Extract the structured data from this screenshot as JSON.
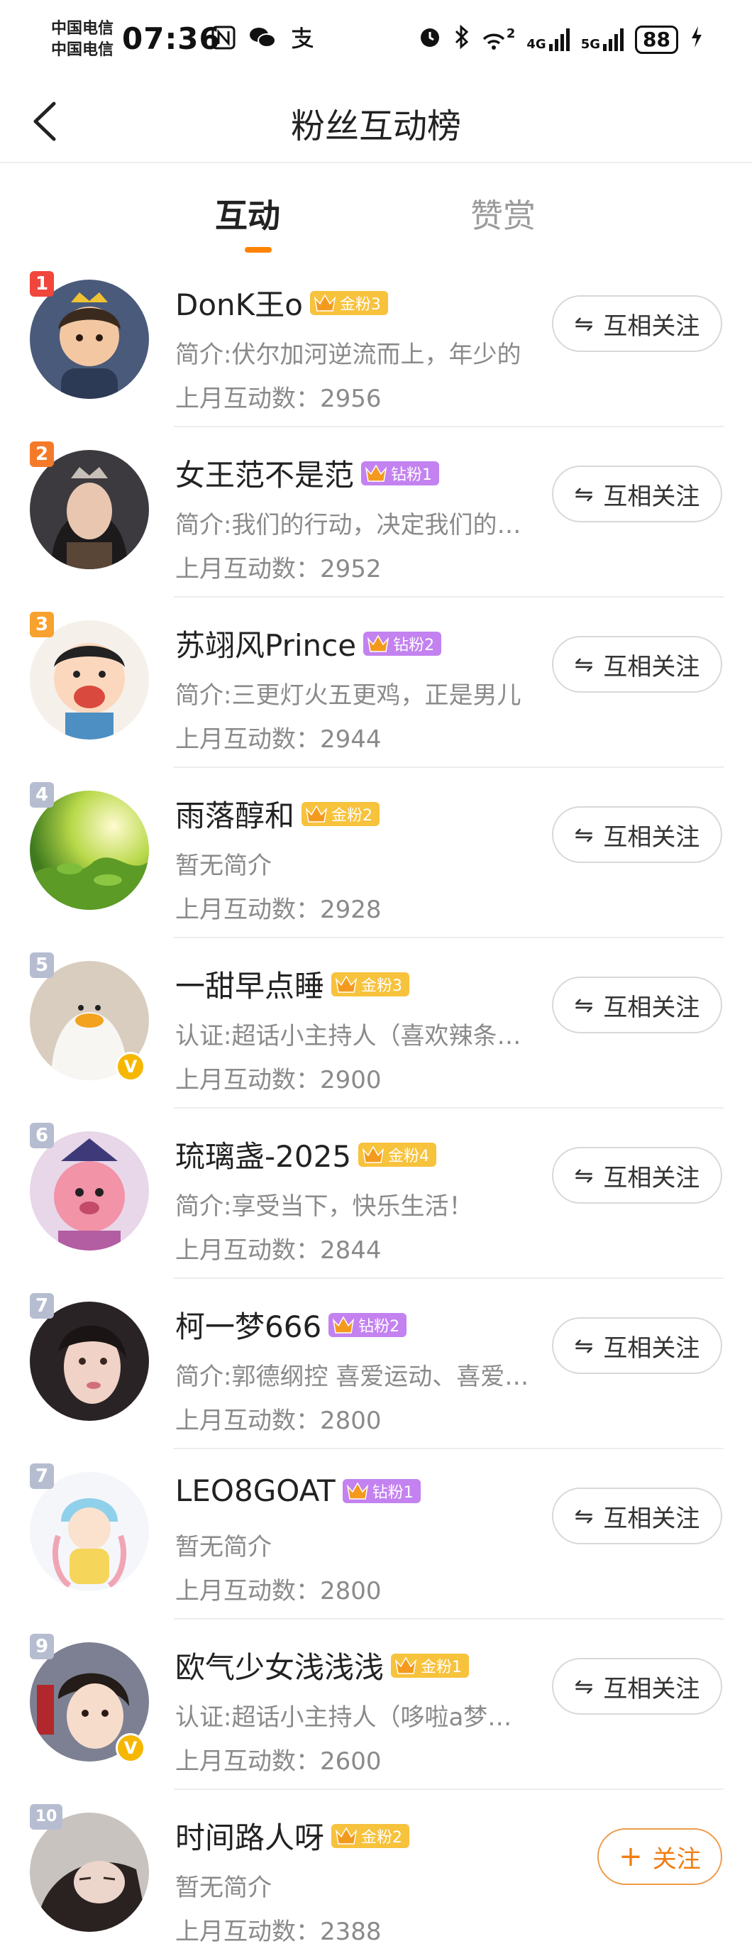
{
  "status_bar": {
    "carrier_1": "中国电信",
    "carrier_2": "中国电信",
    "time": "07:36",
    "net_1": "4G",
    "net_2": "5G",
    "sim_index": "2",
    "battery": "88",
    "left_icons": [
      "nfc-icon",
      "wechat-icon",
      "alipay-icon"
    ],
    "right_icons": [
      "alarm-icon",
      "bluetooth-icon",
      "wifi-icon",
      "signal-icon",
      "signal-icon",
      "charging-icon"
    ]
  },
  "header": {
    "title": "粉丝互动榜",
    "back_icon": "back-arrow-icon"
  },
  "tabs": [
    {
      "label": "互动",
      "active": true
    },
    {
      "label": "赞赏",
      "active": false
    }
  ],
  "colors": {
    "accent": "#ff8200",
    "rank_1": "#f0463c",
    "rank_2": "#f47a2a",
    "rank_3": "#f7a12e",
    "rank_other": "#b6bdd0",
    "gold_badge": "#f7c23c",
    "diamond_badge": "#c382f0"
  },
  "users": [
    {
      "rank": "1",
      "name": "DonK王o",
      "badge": "金粉3",
      "badge_level": "4",
      "badge_type": "gold",
      "desc": "简介:伏尔加河逆流而上，年少的",
      "count": "上月互动数：2956",
      "button": "互相关注",
      "button_icon": "mutual-follow-icon",
      "verified": false
    },
    {
      "rank": "2",
      "name": "女王范不是范",
      "badge": "钻粉1",
      "badge_level": "5",
      "badge_type": "diamond",
      "desc": "简介:我们的行动，决定我们的未来",
      "count": "上月互动数：2952",
      "button": "互相关注",
      "button_icon": "mutual-follow-icon",
      "verified": false
    },
    {
      "rank": "3",
      "name": "苏翊风Prince",
      "badge": "钻粉2",
      "badge_level": "6",
      "badge_type": "diamond",
      "desc": "简介:三更灯火五更鸡，正是男儿",
      "count": "上月互动数：2944",
      "button": "互相关注",
      "button_icon": "mutual-follow-icon",
      "verified": false
    },
    {
      "rank": "4",
      "name": "雨落醇和",
      "badge": "金粉2",
      "badge_level": "6",
      "badge_type": "gold",
      "desc": "暂无简介",
      "count": "上月互动数：2928",
      "button": "互相关注",
      "button_icon": "mutual-follow-icon",
      "verified": false
    },
    {
      "rank": "5",
      "name": "一甜早点睡",
      "badge": "金粉3",
      "badge_level": "6",
      "badge_type": "gold",
      "desc": "认证:超话小主持人（喜欢辣条超话",
      "count": "上月互动数：2900",
      "button": "互相关注",
      "button_icon": "mutual-follow-icon",
      "verified": true
    },
    {
      "rank": "6",
      "name": "琉璃盏-2025",
      "badge": "金粉4",
      "badge_level": "6",
      "badge_type": "gold",
      "desc": "简介:享受当下，快乐生活！",
      "count": "上月互动数：2844",
      "button": "互相关注",
      "button_icon": "mutual-follow-icon",
      "verified": false
    },
    {
      "rank": "7",
      "name": "柯一梦666",
      "badge": "钻粉2",
      "badge_level": "6",
      "badge_type": "diamond",
      "desc": "简介:郭德纲控 喜爱运动、喜爱音乐",
      "count": "上月互动数：2800",
      "button": "互相关注",
      "button_icon": "mutual-follow-icon",
      "verified": false
    },
    {
      "rank": "7",
      "name": "LEO8GOAT",
      "badge": "钻粉1",
      "badge_level": "6",
      "badge_type": "diamond",
      "desc": "暂无简介",
      "count": "上月互动数：2800",
      "button": "互相关注",
      "button_icon": "mutual-follow-icon",
      "verified": false
    },
    {
      "rank": "9",
      "name": "欧气少女浅浅浅",
      "badge": "金粉1",
      "badge_level": "6",
      "badge_type": "gold",
      "desc": "认证:超话小主持人（哆啦a梦超话",
      "count": "上月互动数：2600",
      "button": "互相关注",
      "button_icon": "mutual-follow-icon",
      "verified": true
    },
    {
      "rank": "10",
      "name": "时间路人呀",
      "badge": "金粉2",
      "badge_level": "6",
      "badge_type": "gold",
      "desc": "暂无简介",
      "count": "上月互动数：2388",
      "button": "关注",
      "button_icon": "plus-icon",
      "verified": false
    }
  ]
}
